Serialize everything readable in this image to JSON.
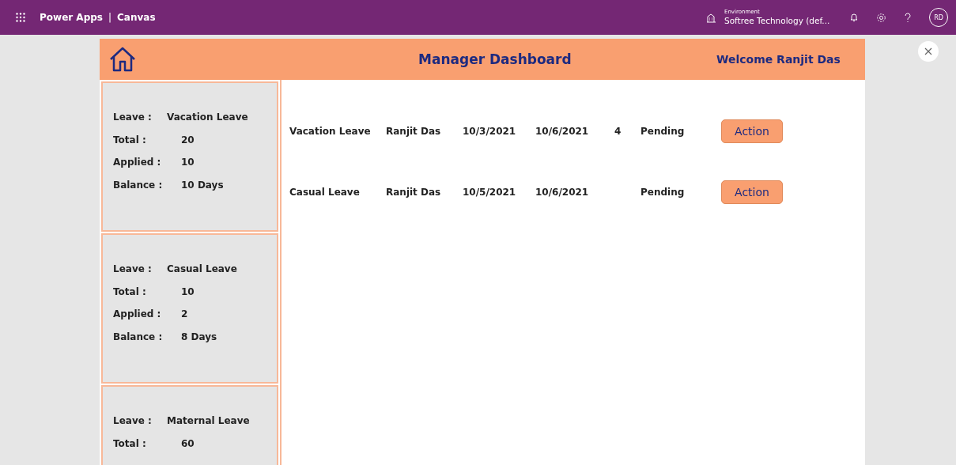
{
  "topbar": {
    "app": "Power Apps",
    "separator": "|",
    "product": "Canvas",
    "environment_label": "Environment",
    "environment": "Softree Technology (def...",
    "avatar": "RD"
  },
  "header": {
    "title": "Manager Dashboard",
    "welcome": "Welcome Ranjit Das"
  },
  "cards": [
    {
      "fields": [
        {
          "label": "Leave :",
          "value": "Vacation Leave"
        },
        {
          "label": "Total :",
          "value": "20"
        },
        {
          "label": "Applied :",
          "value": "10"
        },
        {
          "label": "Balance :",
          "value": "10 Days"
        }
      ]
    },
    {
      "fields": [
        {
          "label": "Leave :",
          "value": "Casual Leave"
        },
        {
          "label": "Total :",
          "value": "10"
        },
        {
          "label": "Applied :",
          "value": "2"
        },
        {
          "label": "Balance :",
          "value": "8 Days"
        }
      ]
    },
    {
      "fields": [
        {
          "label": "Leave :",
          "value": "Maternal Leave"
        },
        {
          "label": "Total :",
          "value": "60"
        }
      ]
    }
  ],
  "requests": [
    {
      "cells": [
        "Vacation Leave",
        "Ranjit Das",
        "10/3/2021",
        "10/6/2021",
        "4",
        "Pending"
      ],
      "button": "Action"
    },
    {
      "cells": [
        "Casual Leave",
        "Ranjit Das",
        "10/5/2021",
        "10/6/2021",
        "",
        "Pending"
      ],
      "button": "Action"
    }
  ]
}
